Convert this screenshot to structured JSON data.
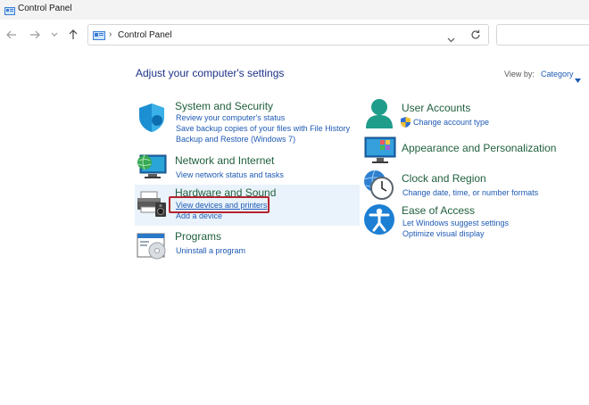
{
  "window": {
    "title": "Control Panel"
  },
  "address": {
    "crumb": "Control Panel"
  },
  "main": {
    "heading": "Adjust your computer's settings",
    "view_by_label": "View by:",
    "view_by_value": "Category"
  },
  "categories": {
    "system": {
      "title": "System and Security",
      "links": [
        "Review your computer's status",
        "Save backup copies of your files with File History",
        "Backup and Restore (Windows 7)"
      ]
    },
    "network": {
      "title": "Network and Internet",
      "links": [
        "View network status and tasks"
      ]
    },
    "hardware": {
      "title": "Hardware and Sound",
      "links": [
        "View devices and printers",
        "Add a device"
      ]
    },
    "programs": {
      "title": "Programs",
      "links": [
        "Uninstall a program"
      ]
    },
    "users": {
      "title": "User Accounts",
      "links": [
        "Change account type"
      ]
    },
    "appearance": {
      "title": "Appearance and Personalization",
      "links": []
    },
    "clock": {
      "title": "Clock and Region",
      "links": [
        "Change date, time, or number formats"
      ]
    },
    "ease": {
      "title": "Ease of Access",
      "links": [
        "Let Windows suggest settings",
        "Optimize visual display"
      ]
    }
  },
  "colors": {
    "link": "#1e5ab4",
    "category_title": "#1f5f3d",
    "heading": "#1e3287",
    "highlight_border": "#b3242f"
  }
}
